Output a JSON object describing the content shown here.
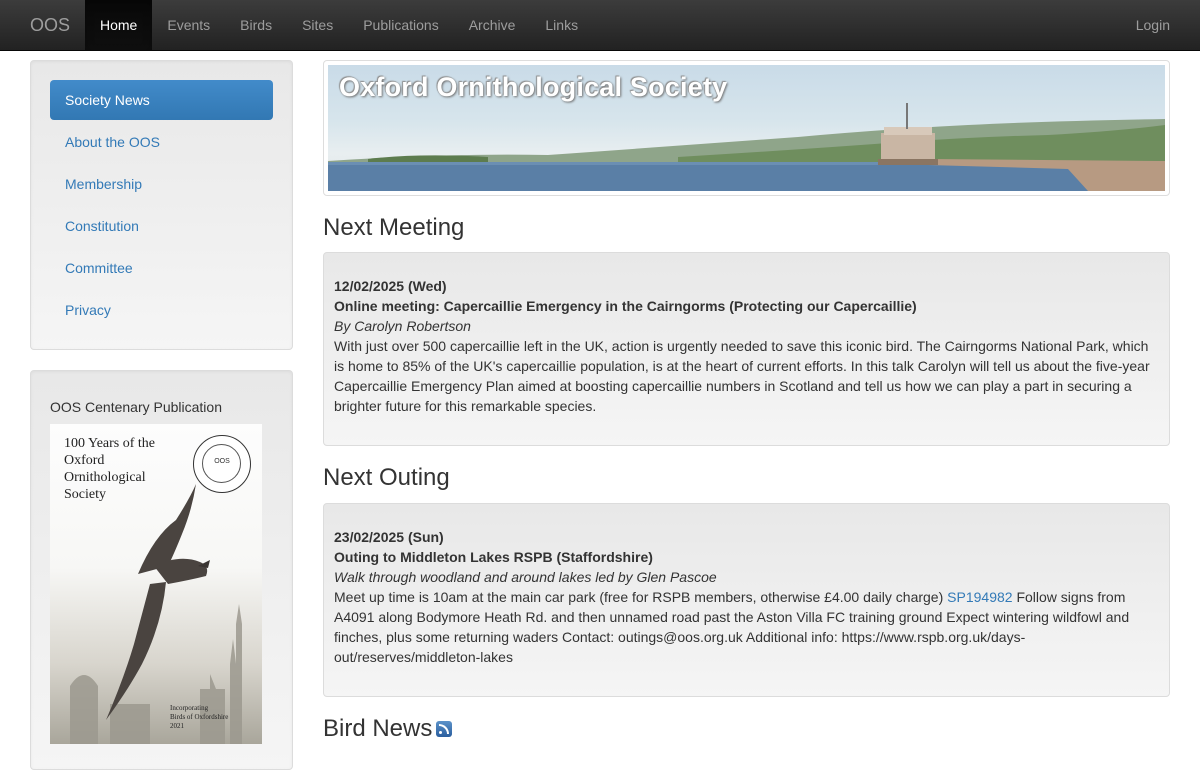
{
  "navbar": {
    "brand": "OOS",
    "items": [
      "Home",
      "Events",
      "Birds",
      "Sites",
      "Publications",
      "Archive",
      "Links"
    ],
    "active": "Home",
    "login": "Login"
  },
  "sidebar": {
    "items": [
      "Society News",
      "About the OOS",
      "Membership",
      "Constitution",
      "Committee",
      "Privacy"
    ],
    "active": "Society News"
  },
  "publication": {
    "heading": "OOS Centenary Publication",
    "book_title_lines": [
      "100 Years of the",
      "Oxford",
      "Ornithological",
      "Society"
    ],
    "seal_text": "OOS",
    "footer_lines": [
      "Incorporating",
      "Birds of Oxfordshire",
      "2021"
    ]
  },
  "banner": {
    "title": "Oxford Ornithological Society"
  },
  "next_meeting": {
    "heading": "Next Meeting",
    "date": "12/02/2025 (Wed)",
    "title": "Online meeting: Capercaillie Emergency in the Cairngorms (Protecting our Capercaillie)",
    "by": "By Carolyn Robertson",
    "body": "With just over 500 capercaillie left in the UK, action is urgently needed to save this iconic bird. The Cairngorms National Park, which is home to 85% of the UK's capercaillie population, is at the heart of current efforts. In this talk Carolyn will tell us about the five-year Capercaillie Emergency Plan aimed at boosting capercaillie numbers in Scotland and tell us how we can play a part in securing a brighter future for this remarkable species."
  },
  "next_outing": {
    "heading": "Next Outing",
    "date": "23/02/2025 (Sun)",
    "title": "Outing to Middleton Lakes RSPB (Staffordshire)",
    "by": "Walk through woodland and around lakes led by Glen Pascoe",
    "body_before": "Meet up time is 10am at the main car park (free for RSPB members, otherwise £4.00 daily charge) ",
    "grid_ref": "SP194982",
    "body_after": " Follow signs from A4091 along Bodymore Heath Rd. and then unnamed road past the Aston Villa FC training ground Expect wintering wildfowl and finches, plus some returning waders Contact: outings@oos.org.uk Additional info: https://www.rspb.org.uk/days-out/reserves/middleton-lakes"
  },
  "bird_news": {
    "heading": "Bird News"
  },
  "colors": {
    "accent": "#428bca",
    "link": "#337ab7",
    "navbar": "#222222"
  }
}
